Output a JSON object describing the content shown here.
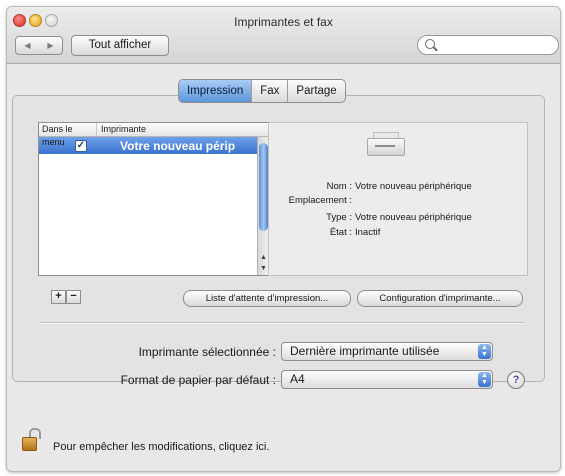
{
  "window": {
    "title": "Imprimantes et fax",
    "show_all_label": "Tout afficher",
    "search_placeholder": ""
  },
  "tabs": [
    {
      "label": "Impression",
      "active": true
    },
    {
      "label": "Fax",
      "active": false
    },
    {
      "label": "Partage",
      "active": false
    }
  ],
  "printer_list": {
    "columns": [
      "Dans le menu",
      "Imprimante"
    ],
    "rows": [
      {
        "in_menu": true,
        "name": "Votre nouveau périp",
        "selected": true
      }
    ]
  },
  "details": {
    "icon": "printer-icon",
    "fields": [
      {
        "label": "Nom :",
        "value": "Votre nouveau périphérique"
      },
      {
        "label": "Emplacement :",
        "value": ""
      },
      {
        "label": "Type :",
        "value": "Votre nouveau périphérique"
      },
      {
        "label": "État :",
        "value": "Inactif"
      }
    ]
  },
  "list_buttons": {
    "add": "+",
    "remove": "−"
  },
  "actions": {
    "queue": "Liste d'attente d'impression...",
    "configure": "Configuration d'imprimante..."
  },
  "selected_printer": {
    "label": "Imprimante sélectionnée :",
    "value": "Dernière imprimante utilisée"
  },
  "paper_size": {
    "label": "Format de papier par défaut :",
    "value": "A4"
  },
  "help_label": "?",
  "lock_text": "Pour empêcher les modifications, cliquez ici.",
  "colors": {
    "accent": "#3b72d0",
    "tab_active": "#6fa0e8",
    "window_bg": "#e8e8e8"
  }
}
